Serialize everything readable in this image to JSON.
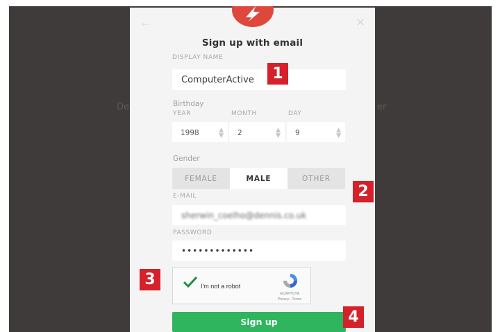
{
  "background": {
    "left_text": "De",
    "right_text": "er"
  },
  "modal": {
    "back_icon": "back-arrow-icon",
    "close_icon": "close-icon",
    "title": "Sign up with email",
    "display_name": {
      "label": "DISPLAY NAME",
      "value": "ComputerActive"
    },
    "birthday": {
      "label": "Birthday",
      "year": {
        "label": "YEAR",
        "value": "1998"
      },
      "month": {
        "label": "MONTH",
        "value": "2"
      },
      "day": {
        "label": "DAY",
        "value": "9"
      }
    },
    "gender": {
      "label": "Gender",
      "options": [
        "FEMALE",
        "MALE",
        "OTHER"
      ],
      "selected": "MALE"
    },
    "email": {
      "label": "E-MAIL",
      "value": "sherwin_coelho@dennis.co.uk"
    },
    "password": {
      "label": "PASSWORD",
      "value": "•••••••••••••"
    },
    "captcha": {
      "label": "I'm not a robot",
      "brand": "reCAPTCHA",
      "links": "Privacy - Terms"
    },
    "signup_label": "Sign up"
  },
  "annotations": [
    "1",
    "2",
    "3",
    "4"
  ],
  "colors": {
    "accent_green": "#2fb55e",
    "logo_red": "#e0473c",
    "badge_red": "#d4212a",
    "backdrop": "#3f3b3a"
  }
}
